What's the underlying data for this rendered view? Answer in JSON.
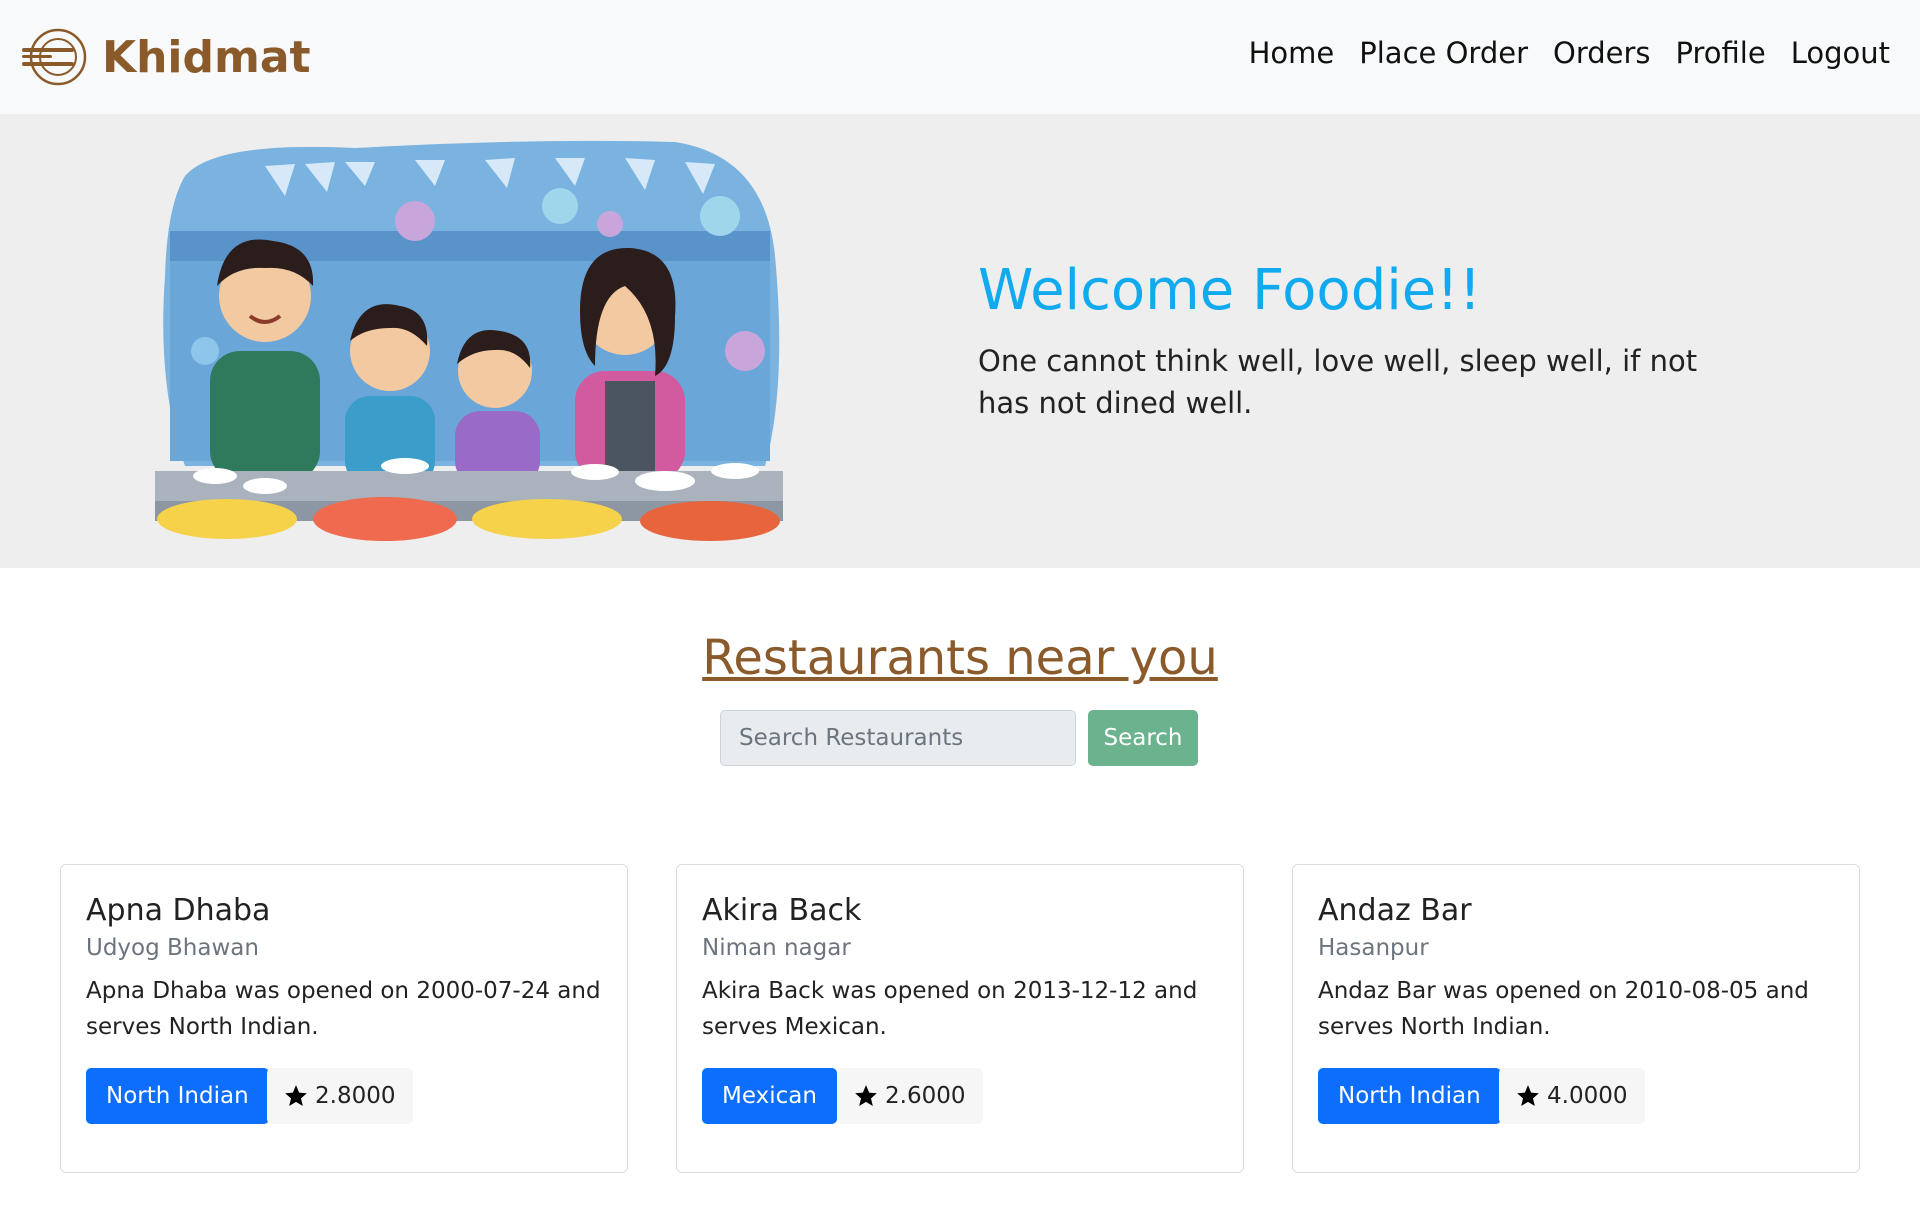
{
  "brand": {
    "name": "Khidmat",
    "logo_icon": "plate-fork-icon",
    "color": "#8a5a2b"
  },
  "nav": {
    "items": [
      {
        "label": "Home"
      },
      {
        "label": "Place Order"
      },
      {
        "label": "Orders"
      },
      {
        "label": "Profile"
      },
      {
        "label": "Logout"
      }
    ]
  },
  "hero": {
    "illustration": "family-eating-illustration",
    "title": "Welcome Foodie!!",
    "quote": "One cannot think well, love well, sleep well, if not has not dined well.",
    "title_color": "#11aaee"
  },
  "section": {
    "title": "Restaurants near you"
  },
  "search": {
    "placeholder": "Search Restaurants",
    "button_label": "Search",
    "button_color": "#6bb28e"
  },
  "restaurants": [
    {
      "name": "Apna Dhaba",
      "location": "Udyog Bhawan",
      "description": "Apna Dhaba was opened on 2000-07-24 and serves North Indian.",
      "cuisine": "North Indian",
      "rating": "2.8000"
    },
    {
      "name": "Akira Back",
      "location": "Niman nagar",
      "description": "Akira Back was opened on 2013-12-12 and serves Mexican.",
      "cuisine": "Mexican",
      "rating": "2.6000"
    },
    {
      "name": "Andaz Bar",
      "location": "Hasanpur",
      "description": "Andaz Bar was opened on 2010-08-05 and serves North Indian.",
      "cuisine": "North Indian",
      "rating": "4.0000"
    }
  ],
  "icons": {
    "rating": "star-icon"
  },
  "colors": {
    "badge": "#0d6efd",
    "hero_bg": "#eeeeee",
    "navbar_bg": "#f8f9fa"
  }
}
